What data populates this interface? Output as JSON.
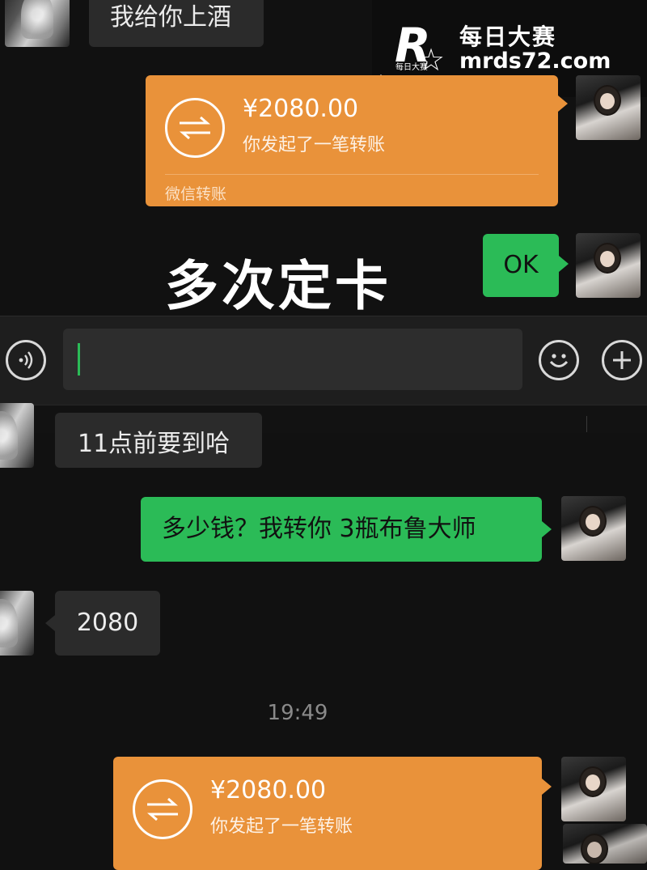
{
  "messages": {
    "msg_top": "我给你上酒",
    "transfer_1": {
      "amount": "¥2080.00",
      "desc": "你发起了一笔转账",
      "brand": "微信转账"
    },
    "ok": "OK",
    "msg_cut": "11点前要到哈",
    "question": "多少钱？我转你 3瓶布鲁大师",
    "price": "2080",
    "timestamp": "19:49",
    "transfer_2": {
      "amount": "¥2080.00",
      "desc": "你发起了一笔转账"
    }
  },
  "overlay": {
    "caption": "多次定卡"
  },
  "watermark": {
    "mark": "R",
    "small": "每日大赛",
    "title": "每日大赛",
    "url": "mrds72.com"
  },
  "input_bar": {
    "voice_icon": "voice-icon",
    "emoji_icon": "emoji-icon",
    "plus_icon": "plus-icon"
  },
  "colors": {
    "green": "#2bbb57",
    "orange": "#e9923a",
    "gray_bubble": "#2b2b2b",
    "background": "#111111"
  }
}
